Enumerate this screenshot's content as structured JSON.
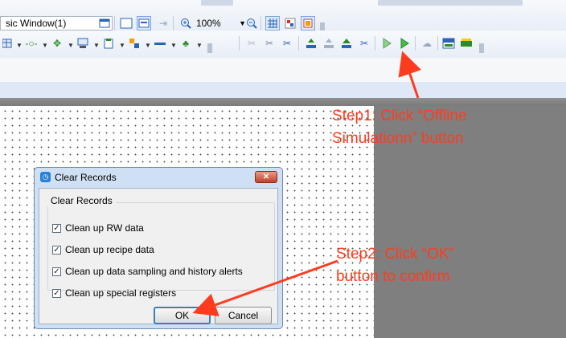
{
  "toolbar": {
    "window_select": "sic Window(1)",
    "zoom": "100%"
  },
  "dialog": {
    "title": "Clear Records",
    "group_title": "Clear Records",
    "options": [
      {
        "label": "Clean up RW data",
        "checked": true
      },
      {
        "label": "Clean up recipe data",
        "checked": true
      },
      {
        "label": "Clean up data sampling and history alerts",
        "checked": true
      },
      {
        "label": "Clean up special registers",
        "checked": true
      }
    ],
    "ok_label": "OK",
    "cancel_label": "Cancel"
  },
  "annotations": {
    "step1_line1": "Step1: Click  “Offline",
    "step1_line2": "Simulationn”  button",
    "step2_line1": "Step2: Click  “OK”",
    "step2_line2": "button to confirm"
  },
  "colors": {
    "annotation": "#ff3b1f",
    "canvas_gray": "#7f7f7f",
    "dialog_frame": "#cfe0f4"
  },
  "icons": [
    "window-icon",
    "zoom-in-icon",
    "zoom-out-icon",
    "grid-icon",
    "offline-simulation-icon",
    "online-simulation-icon",
    "csv-icon",
    "ram-icon"
  ]
}
